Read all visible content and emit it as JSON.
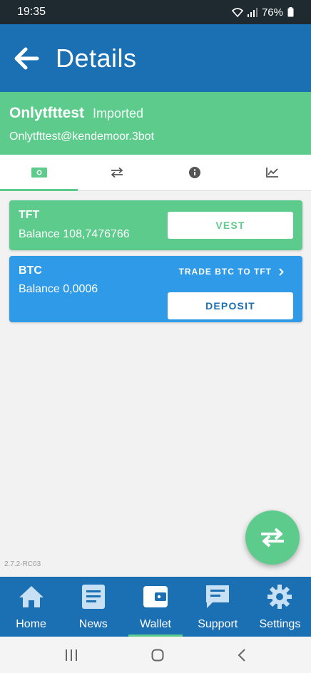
{
  "status_bar": {
    "time": "19:35",
    "battery": "76%"
  },
  "app_bar": {
    "title": "Details"
  },
  "wallet": {
    "name": "Onlytfttest",
    "tag": "Imported",
    "address": "Onlytfttest@kendemoor.3bot"
  },
  "tabs": [
    {
      "icon": "money-icon",
      "active": true
    },
    {
      "icon": "transfer-icon",
      "active": false
    },
    {
      "icon": "info-icon",
      "active": false
    },
    {
      "icon": "chart-icon",
      "active": false
    }
  ],
  "cards": {
    "tft": {
      "symbol": "TFT",
      "balance": "Balance 108,7476766",
      "button": "VEST"
    },
    "btc": {
      "symbol": "BTC",
      "balance": "Balance 0,0006",
      "trade_link": "TRADE BTC TO TFT",
      "button": "DEPOSIT"
    }
  },
  "version": "2.7.2-RC03",
  "bottom_nav": [
    {
      "label": "Home",
      "icon": "home-icon"
    },
    {
      "label": "News",
      "icon": "news-icon"
    },
    {
      "label": "Wallet",
      "icon": "wallet-icon",
      "active": true
    },
    {
      "label": "Support",
      "icon": "chat-icon"
    },
    {
      "label": "Settings",
      "icon": "gear-icon"
    }
  ],
  "colors": {
    "app_bar": "#1b6fb3",
    "green": "#5dcb8c",
    "btc_card": "#2f9ae7"
  }
}
